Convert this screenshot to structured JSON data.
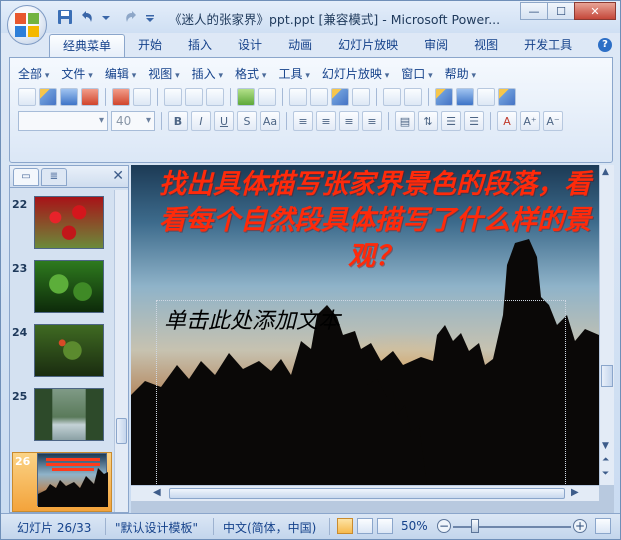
{
  "window": {
    "title": "《迷人的张家界》ppt.ppt [兼容模式] - Microsoft Power...",
    "controls": {
      "minimize": "—",
      "maximize": "☐",
      "close": "✕"
    }
  },
  "ribbon_tabs": [
    "经典菜单",
    "开始",
    "插入",
    "设计",
    "动画",
    "幻灯片放映",
    "审阅",
    "视图",
    "开发工具"
  ],
  "help_label": "?",
  "menu_bar": [
    "全部",
    "文件",
    "编辑",
    "视图",
    "插入",
    "格式",
    "工具",
    "幻灯片放映",
    "窗口",
    "帮助"
  ],
  "font_box": {
    "font_name": "",
    "font_size": "40"
  },
  "format_buttons": [
    "B",
    "I",
    "U",
    "S",
    "Aa"
  ],
  "left_panel": {
    "close_label": "✕",
    "thumbnails": [
      {
        "num": "22",
        "colors": [
          "#c2171a",
          "#6b8a3a"
        ]
      },
      {
        "num": "23",
        "colors": [
          "#2e7a1e",
          "#0d2a0a"
        ]
      },
      {
        "num": "24",
        "colors": [
          "#3f6a22",
          "#1a2c10"
        ]
      },
      {
        "num": "25",
        "colors": [
          "#5a7a5a",
          "#c4d2d6"
        ]
      },
      {
        "num": "26",
        "colors": [
          "#1c3a55",
          "#b58a62"
        ]
      }
    ],
    "selected": "26"
  },
  "slide": {
    "title": "找出具体描写张家界景色的段落，看看每个自然段具体描写了什么样的景观？",
    "placeholder": "单击此处添加文本"
  },
  "status_bar": {
    "slide_info": "幻灯片 26/33",
    "template": "\"默认设计模板\"",
    "language": "中文(简体，中国)",
    "zoom": "50%"
  },
  "colors": {
    "accent": "#15428b",
    "title_red": "#ff2a0a",
    "selected_thumb": "#f3a33b"
  }
}
